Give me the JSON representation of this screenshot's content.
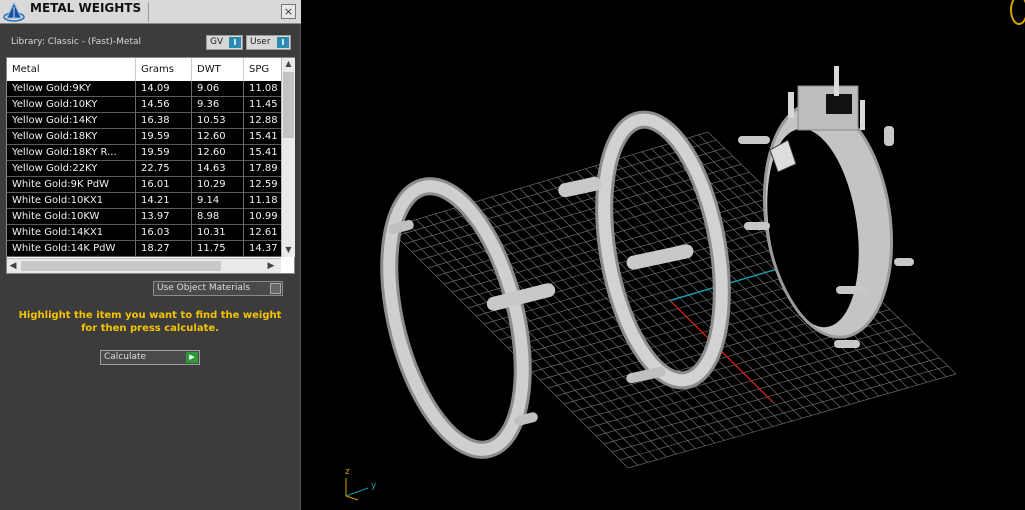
{
  "panel": {
    "title": "METAL WEIGHTS",
    "close_label": "×",
    "library_label": "Library: Classic - (Fast)-Metal",
    "toggle_gv": "GV",
    "toggle_user": "User",
    "columns": [
      "Metal",
      "Grams",
      "DWT",
      "SPG"
    ],
    "rows": [
      {
        "metal": "Yellow Gold:9KY",
        "grams": "14.09",
        "dwt": "9.06",
        "spg": "11.08"
      },
      {
        "metal": "Yellow Gold:10KY",
        "grams": "14.56",
        "dwt": "9.36",
        "spg": "11.45"
      },
      {
        "metal": "Yellow Gold:14KY",
        "grams": "16.38",
        "dwt": "10.53",
        "spg": "12.88"
      },
      {
        "metal": "Yellow Gold:18KY",
        "grams": "19.59",
        "dwt": "12.60",
        "spg": "15.41"
      },
      {
        "metal": "Yellow Gold:18KY R...",
        "grams": "19.59",
        "dwt": "12.60",
        "spg": "15.41"
      },
      {
        "metal": "Yellow Gold:22KY",
        "grams": "22.75",
        "dwt": "14.63",
        "spg": "17.89"
      },
      {
        "metal": "White Gold:9K PdW",
        "grams": "16.01",
        "dwt": "10.29",
        "spg": "12.59"
      },
      {
        "metal": "White Gold:10KX1",
        "grams": "14.21",
        "dwt": "9.14",
        "spg": "11.18"
      },
      {
        "metal": "White Gold:10KW",
        "grams": "13.97",
        "dwt": "8.98",
        "spg": "10.99"
      },
      {
        "metal": "White Gold:14KX1",
        "grams": "16.03",
        "dwt": "10.31",
        "spg": "12.61"
      },
      {
        "metal": "White Gold:14K PdW",
        "grams": "18.27",
        "dwt": "11.75",
        "spg": "14.37"
      }
    ],
    "use_object_materials": "Use Object Materials",
    "instruction": "Highlight the item you want to find the weight for then press calculate.",
    "calculate_label": "Calculate",
    "colors": {
      "instruction": "#f5c400",
      "grid_x_axis": "#c0201a",
      "grid_y_axis": "#1a9aa8"
    }
  },
  "viewport": {
    "axis_z": "z",
    "axis_y": "y"
  }
}
